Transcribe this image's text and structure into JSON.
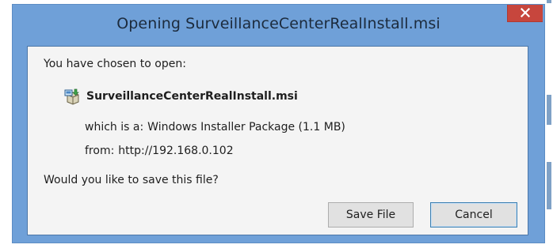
{
  "dialog": {
    "title": "Opening SurveillanceCenterRealInstall.msi",
    "intro": "You have chosen to open:",
    "file_name": "SurveillanceCenterRealInstall.msi",
    "which_is_label": "which is a:",
    "which_is_value": "Windows Installer Package (1.1 MB)",
    "from_label": "from:",
    "from_value": "http://192.168.0.102",
    "question": "Would you like to save this file?",
    "buttons": {
      "save": "Save File",
      "cancel": "Cancel"
    },
    "icons": {
      "close": "close-icon",
      "file": "installer-package-icon"
    }
  },
  "colors": {
    "frame": "#6fa0d8",
    "close_button": "#c7463d",
    "client_background": "#f4f4f4",
    "default_button_border": "#3c7fb1"
  }
}
